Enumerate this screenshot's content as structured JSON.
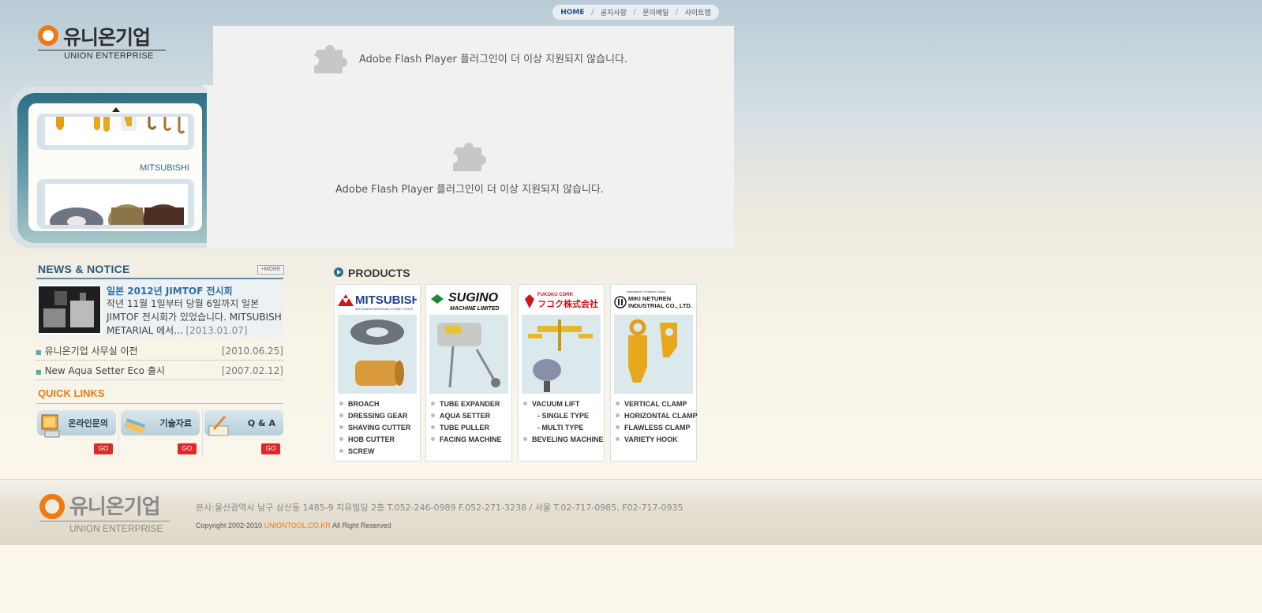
{
  "top_nav": {
    "items": [
      "HOME",
      "공지사항",
      "문의메일",
      "사이트맵"
    ],
    "separator": "/"
  },
  "logo": {
    "korean": "유니온기업",
    "english": "UNION ENTERPRISE"
  },
  "flash": {
    "message_top": "Adobe Flash Player 플러그인이 더 이상 지원되지 않습니다.",
    "message_center": "Adobe Flash Player 플러그인이 더 이상 지원되지 않습니다.",
    "icon": "puzzle-piece-icon"
  },
  "slider": {
    "label": "MITSUBISHI"
  },
  "news": {
    "title": "NEWS & NOTICE",
    "more": "+MORE",
    "featured": {
      "title": "일본 2012년 JIMTOF 전시회",
      "body": "작년 11월 1일부터 당월 6일까지 일본 JIMTOF 전시회가 있었습니다. MITSUBISH METARIAL 에서...",
      "date": "[2013.01.07]"
    },
    "items": [
      {
        "title": "유니온기업 사무실 이전",
        "date": "[2010.06.25]"
      },
      {
        "title": "New Aqua Setter Eco 출시",
        "date": "[2007.02.12]"
      }
    ]
  },
  "quick_links": {
    "title": "QUICK LINKS",
    "items": [
      {
        "label": "온라인문의",
        "go": "GO",
        "icon": "monitor-icon"
      },
      {
        "label": "기술자료",
        "go": "GO",
        "icon": "document-icon"
      },
      {
        "label": "Q & A",
        "go": "GO",
        "icon": "pencil-icon"
      }
    ]
  },
  "products": {
    "title": "PRODUCTS",
    "cards": [
      {
        "brand": "MITSUBISHI",
        "brand_sub": "MITSUBISHI MATERIALS KOBE TOOLS",
        "items": [
          "BROACH",
          "DRESSING GEAR",
          "SHAVING CUTTER",
          "HOB CUTTER",
          "SCREW"
        ]
      },
      {
        "brand": "SUGINO",
        "brand_sub": "MACHINE LIMITED",
        "items": [
          "TUBE EXPANDER",
          "AQUA SETTER",
          "TUBE PULLER",
          "FACING MACHINE"
        ]
      },
      {
        "brand": "FUKOKU CORP.",
        "brand_sub": "フコク株式会社",
        "items": [
          "VACUUM LIFT",
          "- SINGLE TYPE",
          "- MULTI TYPE",
          "BEVELING MACHINE"
        ]
      },
      {
        "brand": "MIKI NETUREN",
        "brand_sub": "INDUSTRIAL CO., LTD.",
        "brand_top": "Manufacturer of Netuero Clamp",
        "items": [
          "VERTICAL CLAMP",
          "HORIZONTAL CLAMP",
          "FLAWLESS CLAMP",
          "VARIETY HOOK"
        ]
      }
    ]
  },
  "footer": {
    "address": "본사:울산광역시 남구 삼산동 1485-9 지유빌딩 2층 T.052-246-0989 F.052-271-3238 / 서울 T.02-717-0985, F02-717-0935",
    "copyright_prefix": "Copyright 2002-2010",
    "domain": "UNIONTOOL.CO.KR",
    "copyright_suffix": "All Right Reserved"
  },
  "colors": {
    "accent_orange": "#f07a12",
    "news_blue": "#2e6fa8",
    "go_red": "#e2262a",
    "slider_teal": "#2f6f86"
  }
}
